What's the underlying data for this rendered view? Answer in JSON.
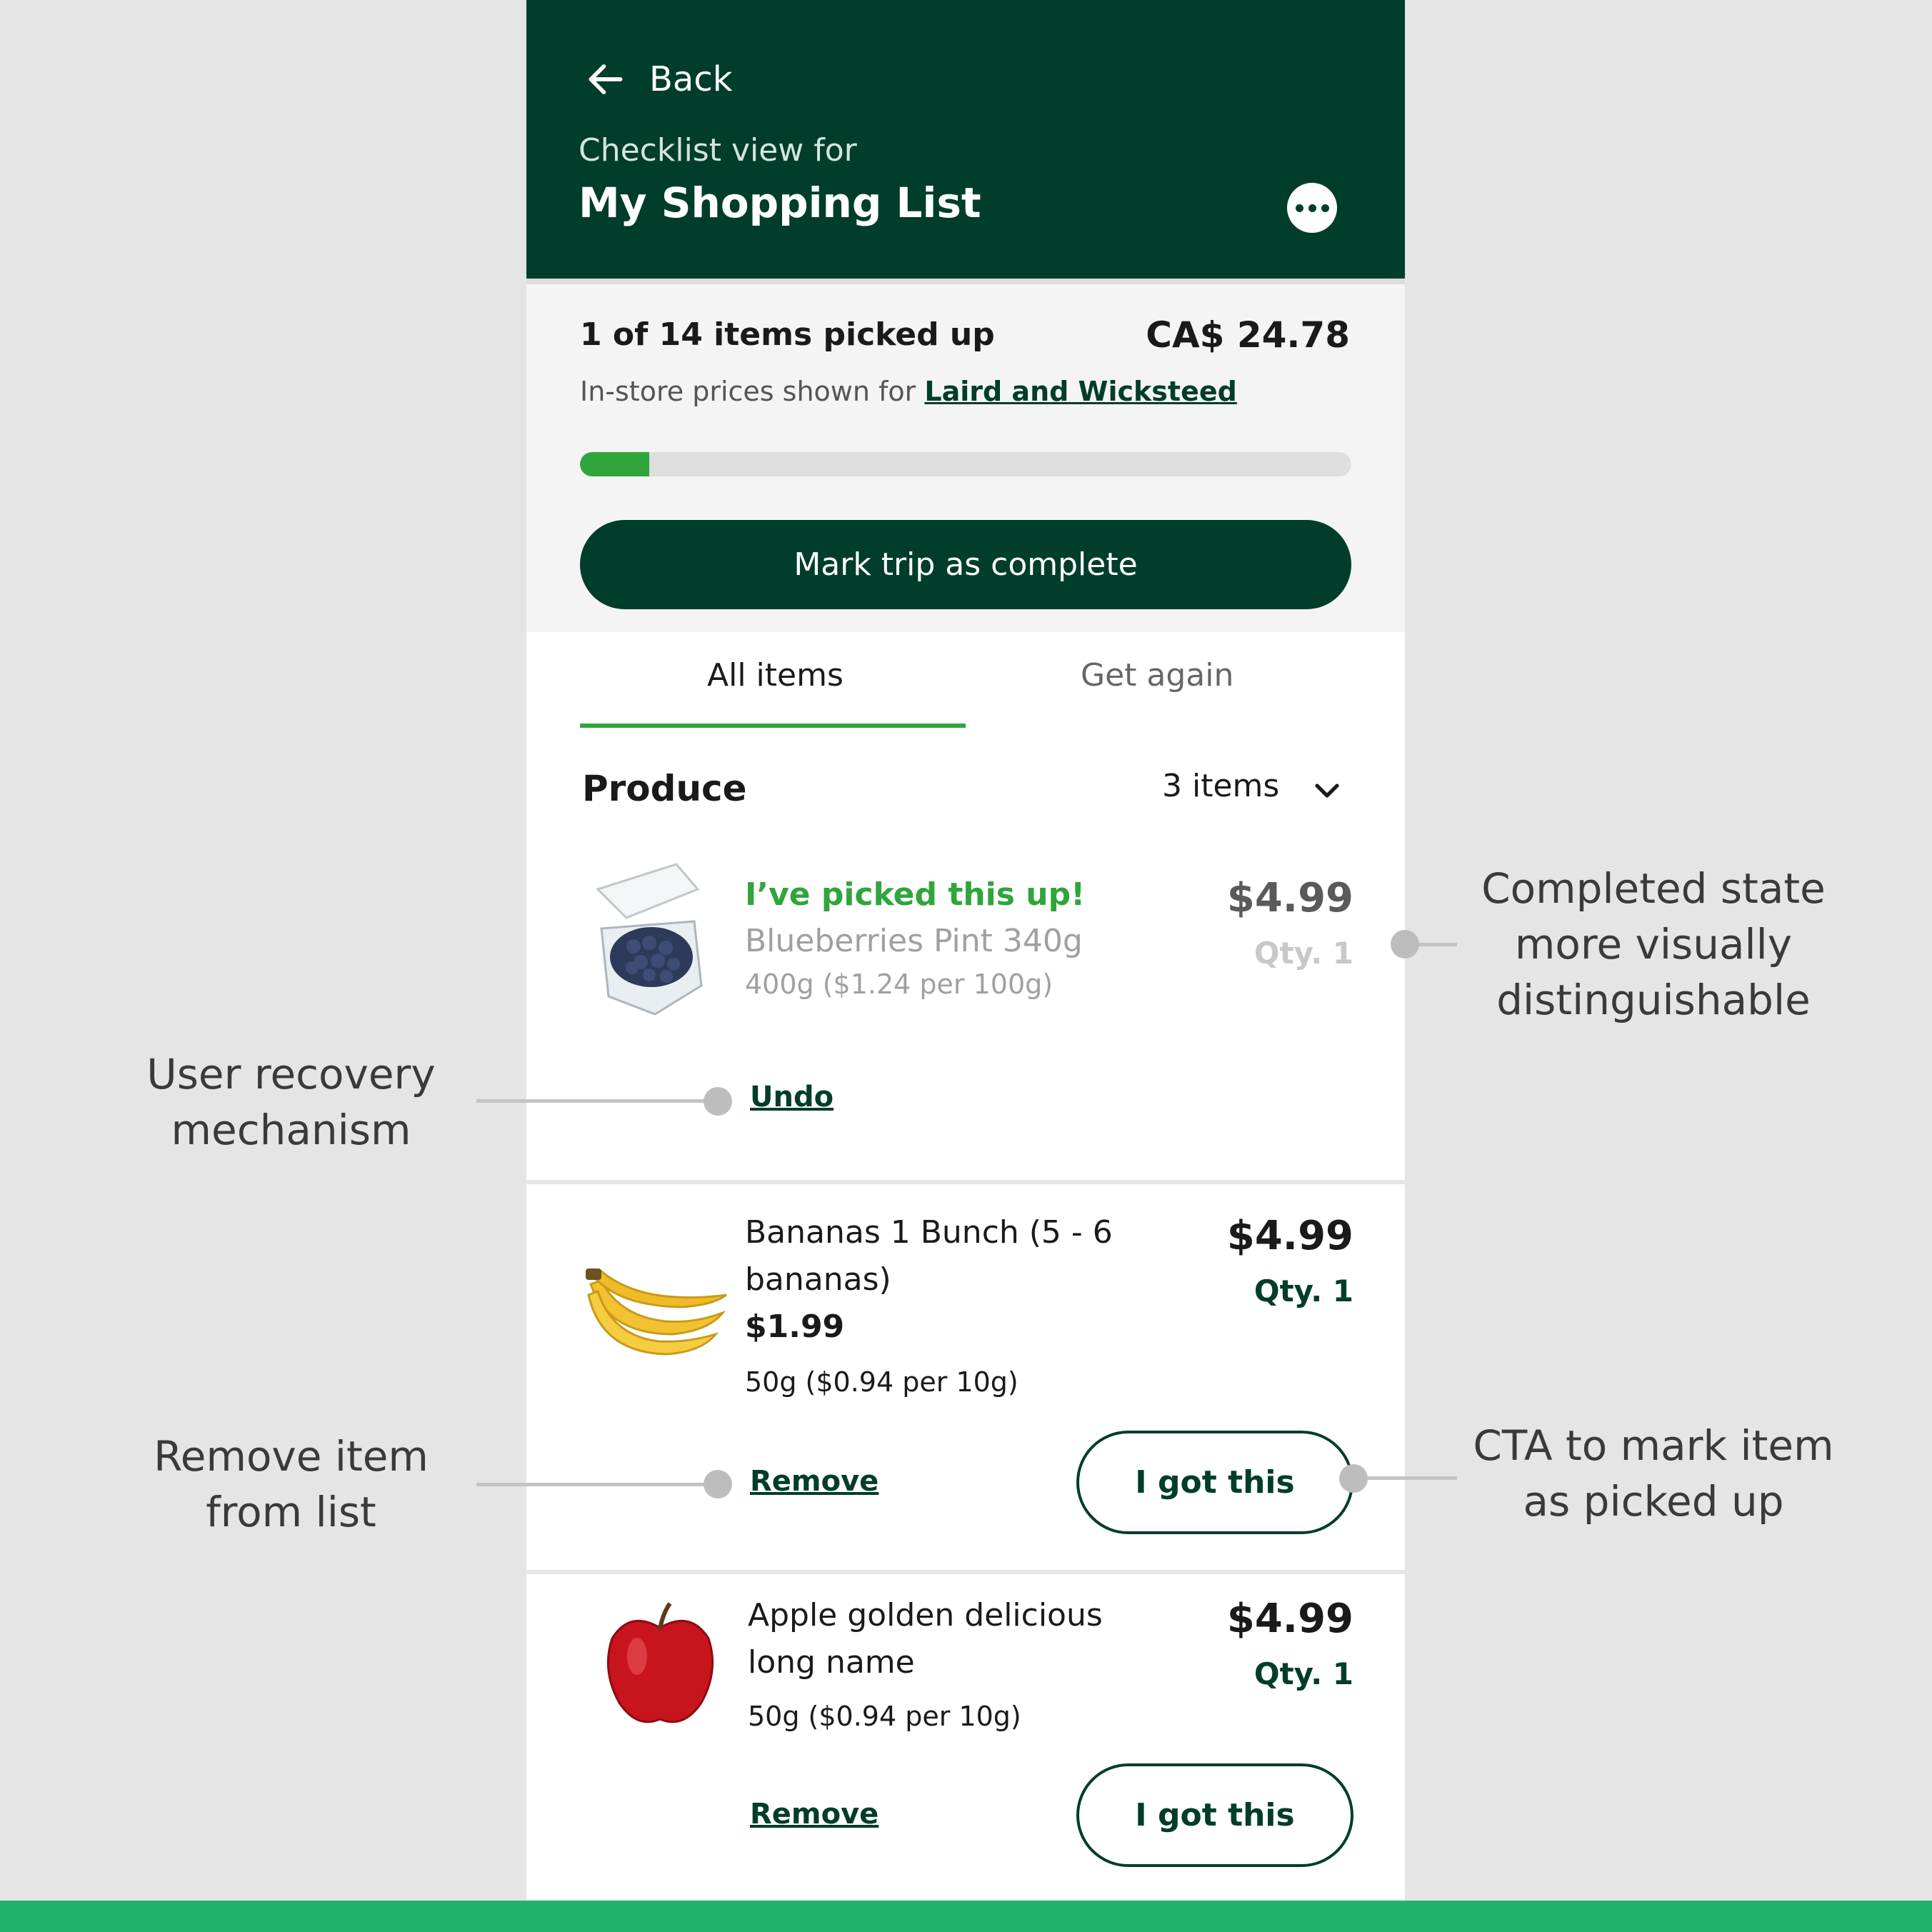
{
  "header": {
    "back_label": "Back",
    "subtitle": "Checklist view for",
    "title": "My Shopping List"
  },
  "summary": {
    "count_text": "1 of 14 items picked up",
    "total": "CA$ 24.78",
    "store_prefix": "In-store prices shown for",
    "store_name": "Laird and Wicksteed",
    "progress": 0.09,
    "mark_complete_label": "Mark trip as complete"
  },
  "tabs": [
    {
      "label": "All items",
      "active": true
    },
    {
      "label": "Get again",
      "active": false
    }
  ],
  "section": {
    "title": "Produce",
    "count": "3 items"
  },
  "items": [
    {
      "status": "I’ve picked this up!",
      "name": "Blueberries Pint 340g",
      "unit": "400g ($1.24 per 100g)",
      "price": "$4.99",
      "qty": "Qty. 1",
      "action": "Undo"
    },
    {
      "name_line1": "Bananas 1 Bunch (5 - 6",
      "name_line2": "bananas)",
      "sale_price": "$1.99",
      "unit": "50g ($0.94 per 10g)",
      "price": "$4.99",
      "qty": "Qty. 1",
      "remove_label": "Remove",
      "cta_label": "I got this"
    },
    {
      "name_line1": "Apple golden delicious",
      "name_line2": "long name",
      "unit": "50g ($0.94 per 10g)",
      "price": "$4.99",
      "qty": "Qty. 1",
      "remove_label": "Remove",
      "cta_label": "I got this"
    }
  ],
  "annotations": {
    "completed_state": [
      "Completed state",
      "more visually",
      "distinguishable"
    ],
    "recovery": [
      "User recovery",
      "mechanism"
    ],
    "remove": [
      "Remove item",
      "from list"
    ],
    "cta": [
      "CTA to mark item",
      "as picked up"
    ]
  },
  "colors": {
    "header_bg": "#003d2b",
    "accent_green": "#2fa53b",
    "bottom_bar": "#22b36a",
    "page_bg": "#e5e5e5"
  }
}
